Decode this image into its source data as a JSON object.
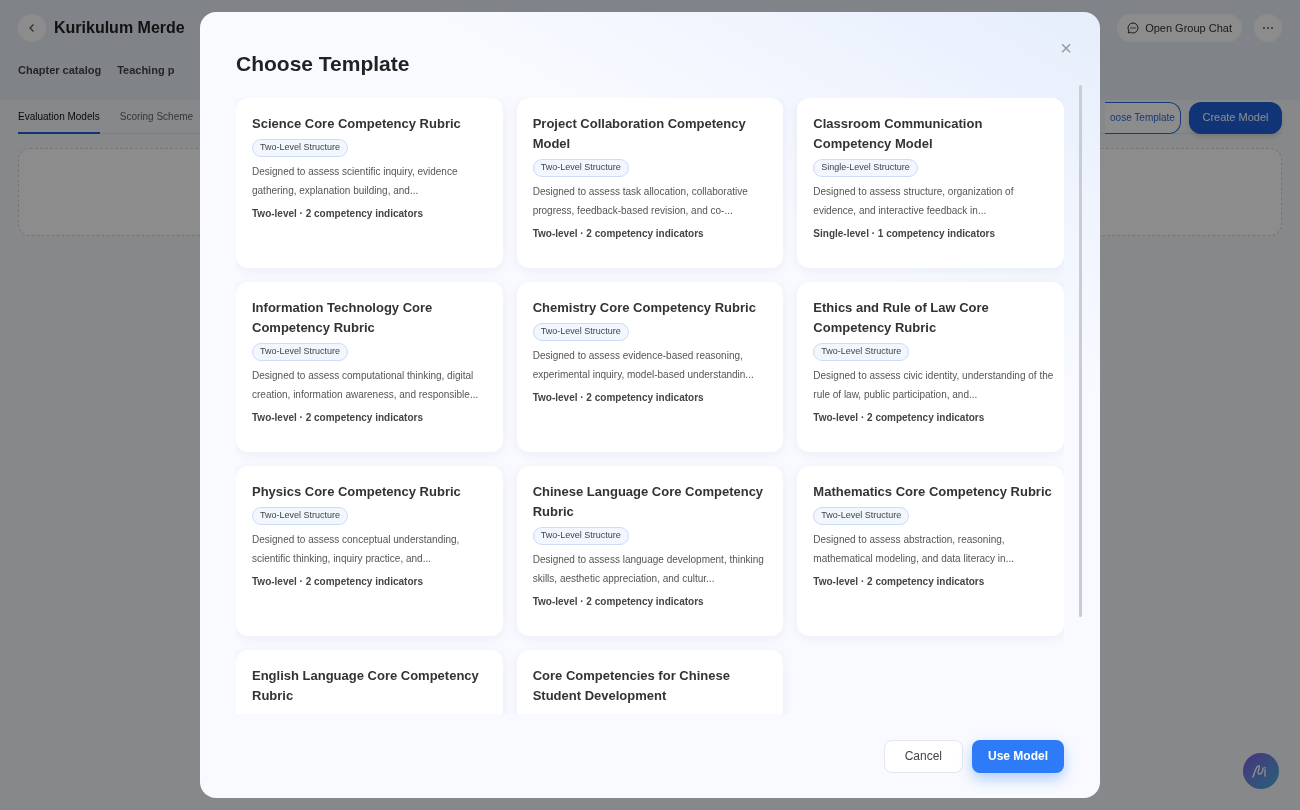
{
  "page": {
    "title": "Kurikulum Merde",
    "tabs": [
      {
        "label": "Chapter catalog",
        "selected": false
      },
      {
        "label": "Teaching p",
        "selected": false
      }
    ],
    "header_buttons": [
      "Open Group Chat",
      "⋯"
    ],
    "subtabs": [
      {
        "label": "Evaluation Models",
        "selected": true
      },
      {
        "label": "Scoring Scheme",
        "selected": false
      }
    ],
    "actions": [
      {
        "label": "oose Template",
        "kind": "outline"
      },
      {
        "label": "Create Model",
        "kind": "primary"
      }
    ]
  },
  "dialog": {
    "title": "Choose Template",
    "close": "×",
    "templates": [
      {
        "title": "Science Core Competency Rubric",
        "tag": "Two-Level Structure",
        "description": "Designed to assess scientific inquiry, evidence gathering, explanation building, and...",
        "meta": "Two-level · 2 competency indicators"
      },
      {
        "title": "Project Collaboration Competency Model",
        "tag": "Two-Level Structure",
        "description": "Designed to assess task allocation, collaborative progress, feedback-based revision, and co-...",
        "meta": "Two-level · 2 competency indicators"
      },
      {
        "title": "Classroom Communication Competency Model",
        "tag": "Single-Level Structure",
        "description": "Designed to assess structure, organization of evidence, and interactive feedback in...",
        "meta": "Single-level · 1 competency indicators"
      },
      {
        "title": "Information Technology Core Competency Rubric",
        "tag": "Two-Level Structure",
        "description": "Designed to assess computational thinking, digital creation, information awareness, and responsible...",
        "meta": "Two-level · 2 competency indicators"
      },
      {
        "title": "Chemistry Core Competency Rubric",
        "tag": "Two-Level Structure",
        "description": "Designed to assess evidence-based reasoning, experimental inquiry, model-based understandin...",
        "meta": "Two-level · 2 competency indicators"
      },
      {
        "title": "Ethics and Rule of Law Core Competency Rubric",
        "tag": "Two-Level Structure",
        "description": "Designed to assess civic identity, understanding of the rule of law, public participation, and...",
        "meta": "Two-level · 2 competency indicators"
      },
      {
        "title": "Physics Core Competency Rubric",
        "tag": "Two-Level Structure",
        "description": "Designed to assess conceptual understanding, scientific thinking, inquiry practice, and...",
        "meta": "Two-level · 2 competency indicators"
      },
      {
        "title": "Chinese Language Core Competency Rubric",
        "tag": "Two-Level Structure",
        "description": "Designed to assess language development, thinking skills, aesthetic appreciation, and cultur...",
        "meta": "Two-level · 2 competency indicators"
      },
      {
        "title": "Mathematics Core Competency Rubric",
        "tag": "Two-Level Structure",
        "description": "Designed to assess abstraction, reasoning, mathematical modeling, and data literacy in...",
        "meta": "Two-level · 2 competency indicators"
      },
      {
        "title": "English Language Core Competency Rubric"
      },
      {
        "title": "Core Competencies for Chinese Student Development"
      }
    ],
    "buttons": [
      {
        "label": "Cancel",
        "kind": "secondary"
      },
      {
        "label": "Use Model",
        "kind": "primary"
      }
    ]
  }
}
